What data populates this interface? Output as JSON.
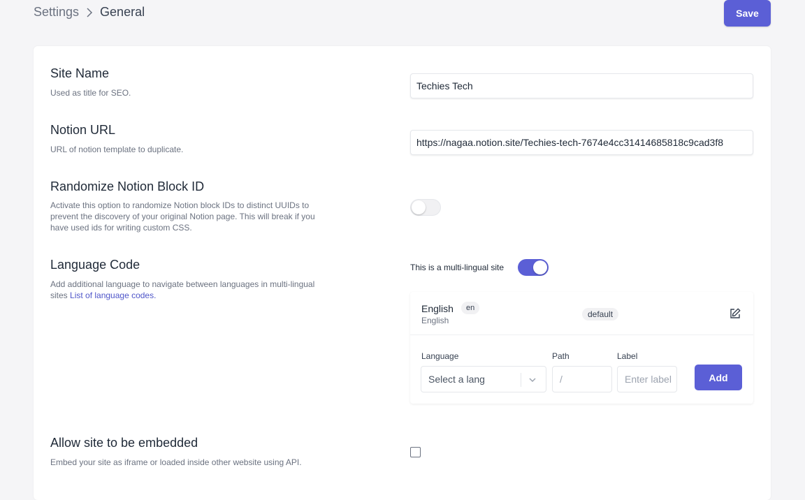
{
  "breadcrumb": {
    "root": "Settings",
    "current": "General"
  },
  "toolbar": {
    "save_label": "Save"
  },
  "site_name": {
    "title": "Site Name",
    "description": "Used as title for SEO.",
    "value": "Techies Tech"
  },
  "notion_url": {
    "title": "Notion URL",
    "description": "URL of notion template to duplicate.",
    "value": "https://nagaa.notion.site/Techies-tech-7674e4cc31414685818c9cad3f8"
  },
  "randomize": {
    "title": "Randomize Notion Block ID",
    "description": "Activate this option to randomize Notion block IDs to distinct UUIDs to prevent the discovery of your original Notion page. This will break if you have used ids for writing custom CSS.",
    "enabled": false
  },
  "language": {
    "title": "Language Code",
    "description": "Add additional language to navigate between languages in multi-lingual sites ",
    "link_text": "List of language codes.",
    "multilingual_label": "This is a multi-lingual site",
    "multilingual_enabled": true,
    "entries": [
      {
        "name": "English",
        "code": "en",
        "subtitle": "English",
        "badge": "default"
      }
    ],
    "form": {
      "language_label": "Language",
      "language_placeholder": "Select a lang",
      "path_label": "Path",
      "path_value": "/",
      "label_label": "Label",
      "label_placeholder": "Enter label",
      "add_label": "Add"
    }
  },
  "embed": {
    "title": "Allow site to be embedded",
    "description": "Embed your site as iframe or loaded inside other website using API.",
    "checked": false
  },
  "colors": {
    "accent": "#5b5fd6"
  }
}
